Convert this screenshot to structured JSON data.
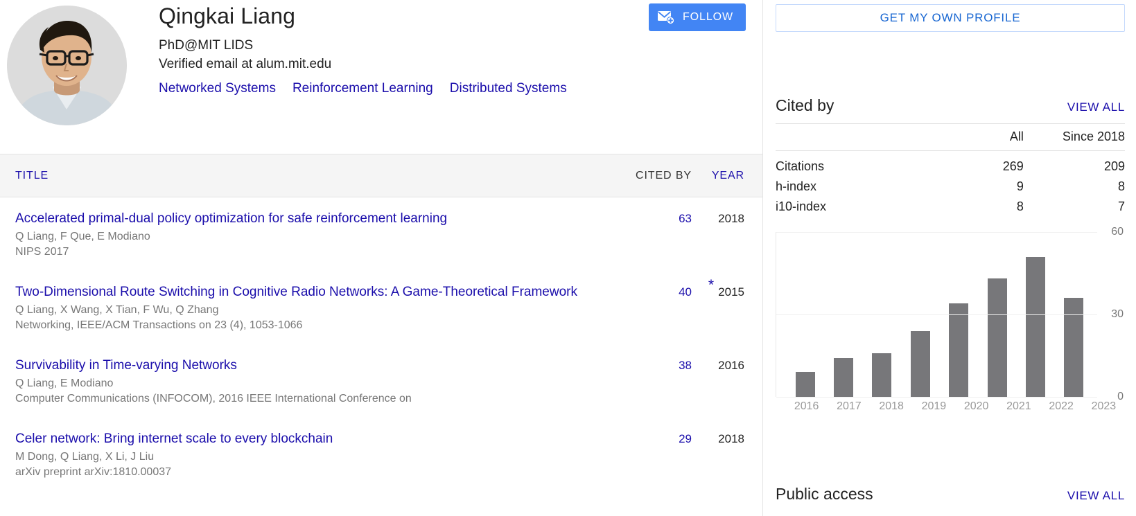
{
  "profile": {
    "name": "Qingkai Liang",
    "affiliation": "PhD@MIT LIDS",
    "verified_email": "Verified email at alum.mit.edu",
    "avatar_alt": "profile-photo",
    "interests": [
      "Networked Systems",
      "Reinforcement Learning",
      "Distributed Systems"
    ],
    "follow_label": "FOLLOW"
  },
  "publications": {
    "headers": {
      "title": "TITLE",
      "cited_by": "CITED BY",
      "year": "YEAR"
    },
    "rows": [
      {
        "title": "Accelerated primal-dual policy optimization for safe reinforcement learning",
        "authors": "Q Liang, F Que, E Modiano",
        "venue": "NIPS 2017",
        "cited_by": "63",
        "year": "2018",
        "star": ""
      },
      {
        "title": "Two-Dimensional Route Switching in Cognitive Radio Networks: A Game-Theoretical Framework",
        "authors": "Q Liang, X Wang, X Tian, F Wu, Q Zhang",
        "venue": "Networking, IEEE/ACM Transactions on 23 (4), 1053-1066",
        "cited_by": "40",
        "year": "2015",
        "star": "*"
      },
      {
        "title": "Survivability in Time-varying Networks",
        "authors": "Q Liang, E Modiano",
        "venue": "Computer Communications (INFOCOM), 2016 IEEE International Conference on",
        "cited_by": "38",
        "year": "2016",
        "star": ""
      },
      {
        "title": "Celer network: Bring internet scale to every blockchain",
        "authors": "M Dong, Q Liang, X Li, J Liu",
        "venue": "arXiv preprint arXiv:1810.00037",
        "cited_by": "29",
        "year": "2018",
        "star": ""
      }
    ]
  },
  "sidebar": {
    "get_profile_label": "GET MY OWN PROFILE",
    "cited_by_title": "Cited by",
    "view_all_label": "VIEW ALL",
    "metrics": {
      "columns": [
        "",
        "All",
        "Since 2018"
      ],
      "rows": [
        {
          "label": "Citations",
          "all": "269",
          "since": "209"
        },
        {
          "label": "h-index",
          "all": "9",
          "since": "8"
        },
        {
          "label": "i10-index",
          "all": "8",
          "since": "7"
        }
      ]
    },
    "public_access": {
      "title": "Public access",
      "view_all_label": "VIEW ALL"
    }
  },
  "chart_data": {
    "type": "bar",
    "title": "",
    "xlabel": "",
    "ylabel": "",
    "categories": [
      "2016",
      "2017",
      "2018",
      "2019",
      "2020",
      "2021",
      "2022",
      "2023"
    ],
    "values": [
      9,
      14,
      16,
      24,
      34,
      43,
      51,
      36
    ],
    "ylim": [
      0,
      60
    ],
    "yticks": [
      60,
      30,
      0
    ],
    "grid": true,
    "legend": false,
    "bar_color": "#77777a"
  }
}
